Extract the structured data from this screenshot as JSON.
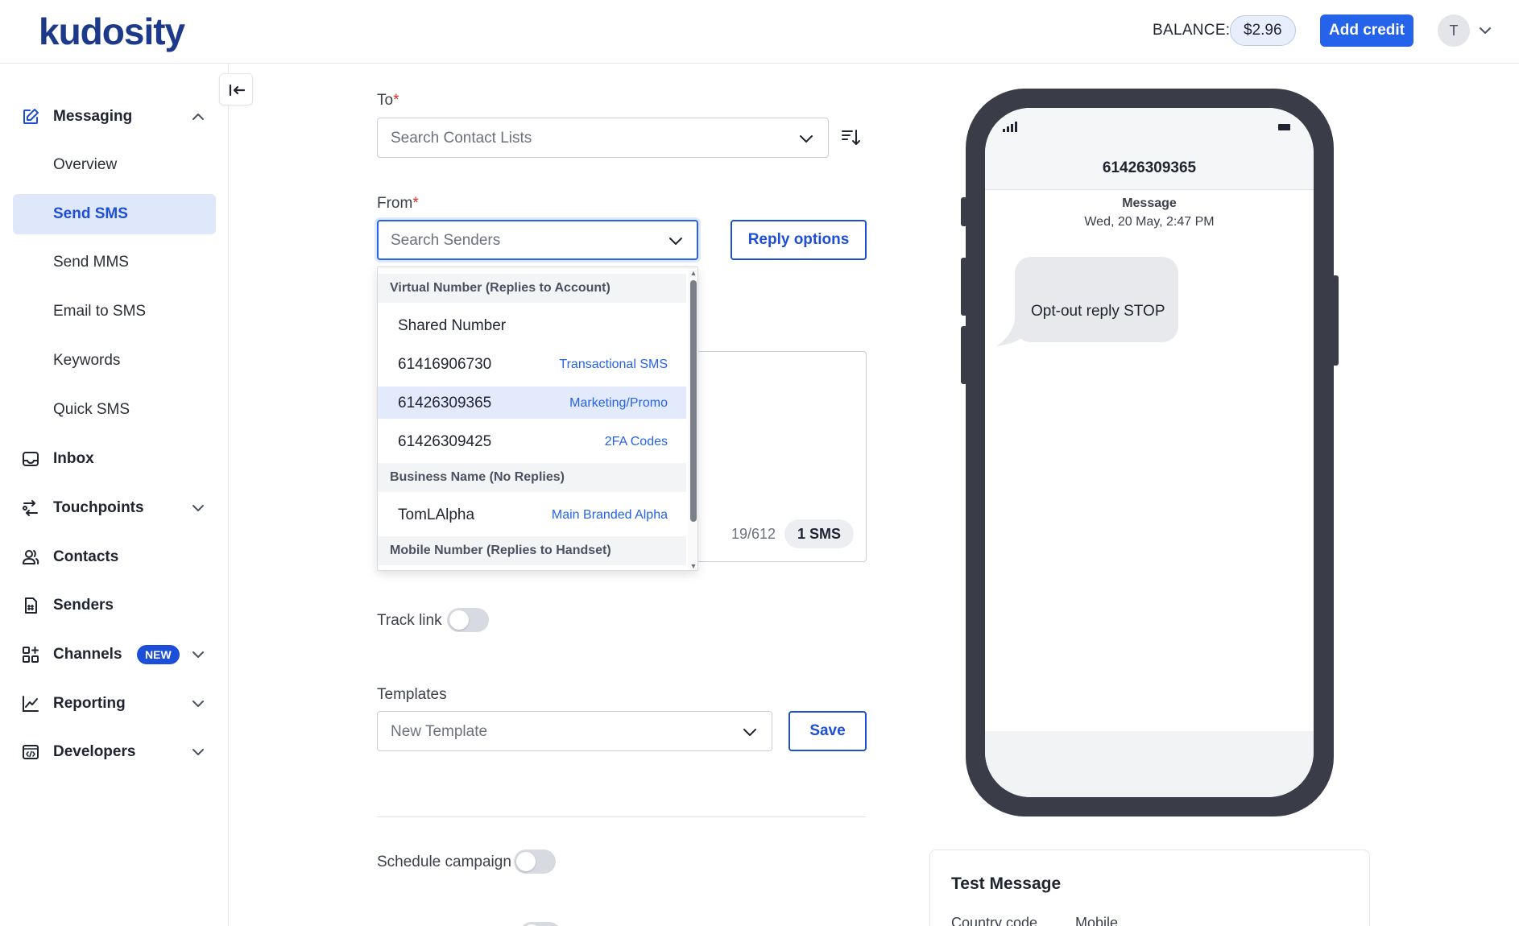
{
  "header": {
    "logo_text": "kudosity",
    "balance_label": "BALANCE:",
    "balance_value": "$2.96",
    "add_credit_label": "Add credit",
    "avatar_initial": "T",
    "accent_color": "#2563eb"
  },
  "sidebar": {
    "messaging": {
      "label": "Messaging",
      "icon": "edit-icon"
    },
    "sub_items": [
      {
        "label": "Overview"
      },
      {
        "label": "Send SMS",
        "active": true
      },
      {
        "label": "Send MMS"
      },
      {
        "label": "Email to SMS"
      },
      {
        "label": "Keywords"
      },
      {
        "label": "Quick SMS"
      }
    ],
    "items": [
      {
        "label": "Inbox",
        "icon": "inbox-icon"
      },
      {
        "label": "Touchpoints",
        "icon": "route-icon"
      },
      {
        "label": "Contacts",
        "icon": "contacts-icon"
      },
      {
        "label": "Senders",
        "icon": "senders-icon"
      },
      {
        "label": "Channels",
        "icon": "channels-icon",
        "badge": "NEW"
      },
      {
        "label": "Reporting",
        "icon": "chart-icon"
      },
      {
        "label": "Developers",
        "icon": "code-icon"
      }
    ]
  },
  "form": {
    "to_label": "To",
    "to_placeholder": "Search Contact Lists",
    "from_label": "From",
    "from_placeholder": "Search Senders",
    "reply_options_label": "Reply options",
    "char_count": "19/612",
    "sms_count": "1 SMS",
    "track_link_label": "Track link",
    "templates_label": "Templates",
    "template_value": "New Template",
    "save_label": "Save",
    "schedule_label": "Schedule campaign",
    "required_marker": "*"
  },
  "sender_dropdown": {
    "groups": [
      {
        "label": "Virtual Number (Replies to Account)"
      },
      {
        "label": "Business Name (No Replies)"
      },
      {
        "label": "Mobile Number (Replies to Handset)"
      }
    ],
    "options": [
      {
        "label": "Shared Number",
        "tag": ""
      },
      {
        "label": "61416906730",
        "tag": "Transactional SMS"
      },
      {
        "label": "61426309365",
        "tag": "Marketing/Promo",
        "highlighted": true
      },
      {
        "label": "61426309425",
        "tag": "2FA Codes"
      },
      {
        "label": "TomLAlpha",
        "tag": "Main Branded Alpha"
      }
    ]
  },
  "preview": {
    "phone_number": "61426309365",
    "message_heading": "Message",
    "message_date": "Wed, 20 May, 2:47 PM",
    "bubble_text": "Opt-out reply STOP"
  },
  "test_message": {
    "title": "Test Message",
    "country_code_label": "Country code",
    "mobile_label": "Mobile"
  }
}
